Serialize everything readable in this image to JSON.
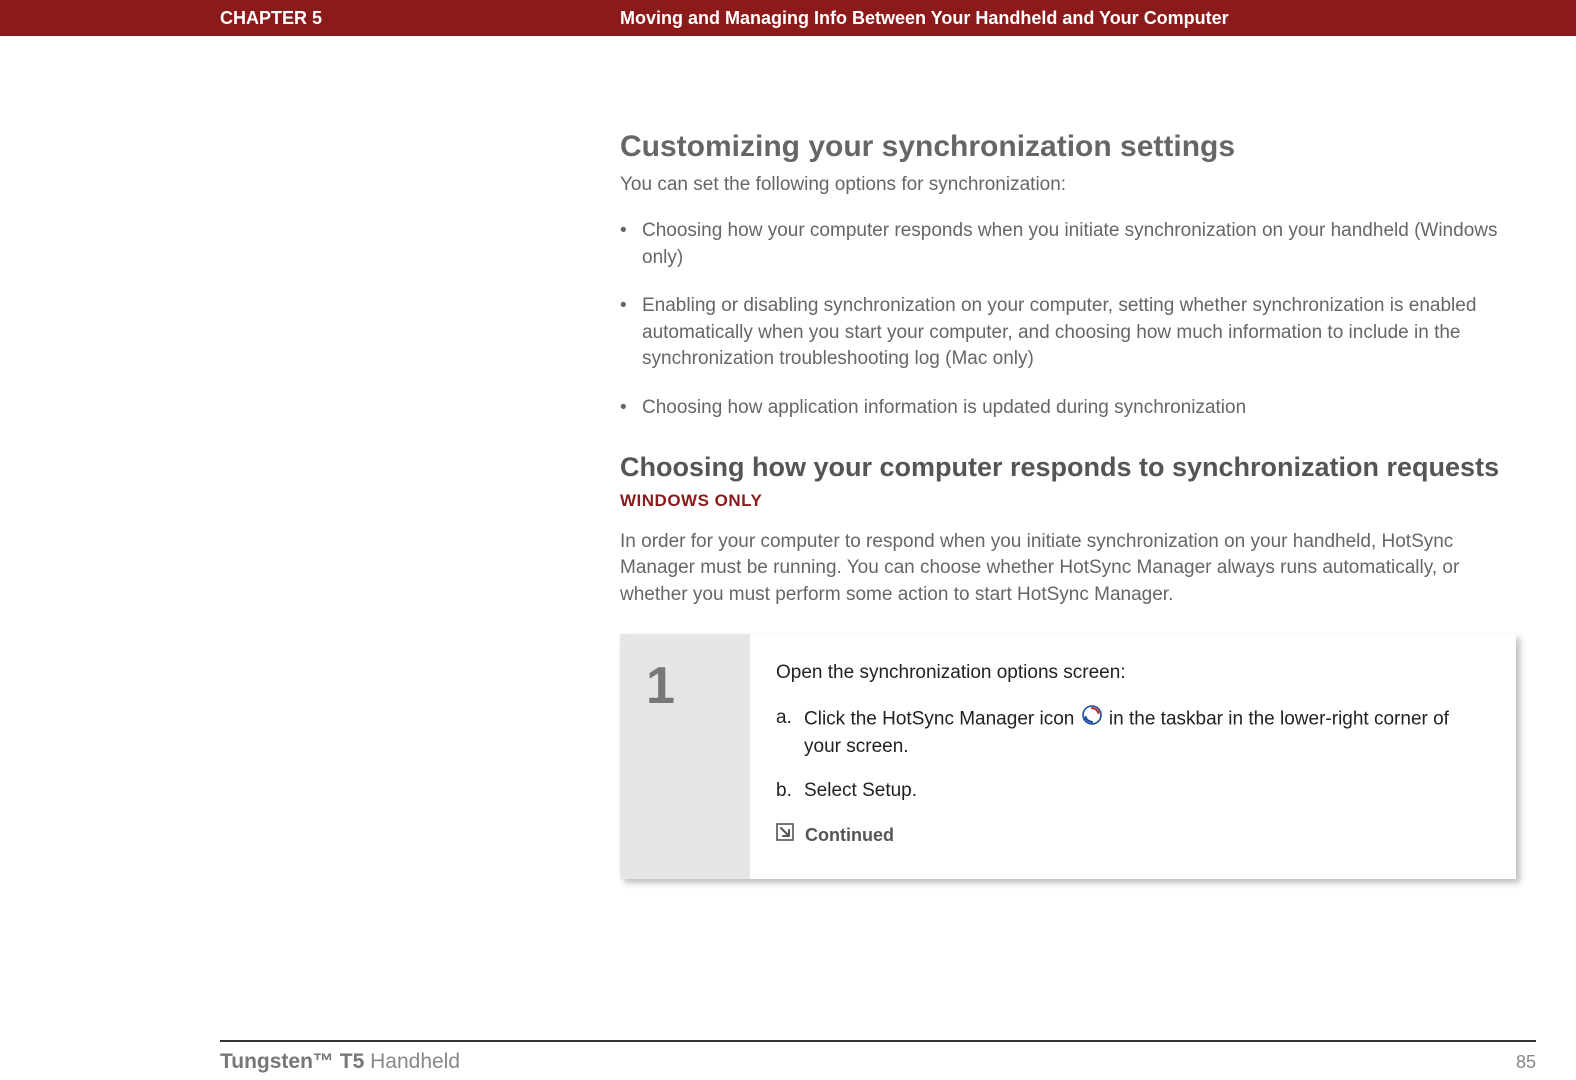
{
  "header": {
    "chapter": "CHAPTER 5",
    "title": "Moving and Managing Info Between Your Handheld and Your Computer"
  },
  "section": {
    "heading": "Customizing your synchronization settings",
    "intro": "You can set the following options for synchronization:",
    "bullets": [
      "Choosing how your computer responds when you initiate synchronization on your handheld (Windows only)",
      "Enabling or disabling synchronization on your computer, setting whether synchronization is enabled automatically when you start your computer, and choosing how much information to include in the synchronization troubleshooting log (Mac only)",
      "Choosing how application information is updated during synchronization"
    ]
  },
  "subsection": {
    "heading": "Choosing how your computer responds to synchronization requests",
    "platform": "WINDOWS ONLY",
    "description": "In order for your computer to respond when you initiate synchronization on your handheld, HotSync Manager must be running. You can choose whether HotSync Manager always runs automatically, or whether you must perform some action to start HotSync Manager."
  },
  "step": {
    "number": "1",
    "intro": "Open the synchronization options screen:",
    "sub_a_label": "a.",
    "sub_a_before": "Click the HotSync Manager icon ",
    "sub_a_after": " in the taskbar in the lower-right corner of your screen.",
    "sub_b_label": "b.",
    "sub_b_text": "Select Setup.",
    "continued": "Continued"
  },
  "footer": {
    "product_bold": "Tungsten™ T5",
    "product_rest": " Handheld",
    "page": "85"
  }
}
